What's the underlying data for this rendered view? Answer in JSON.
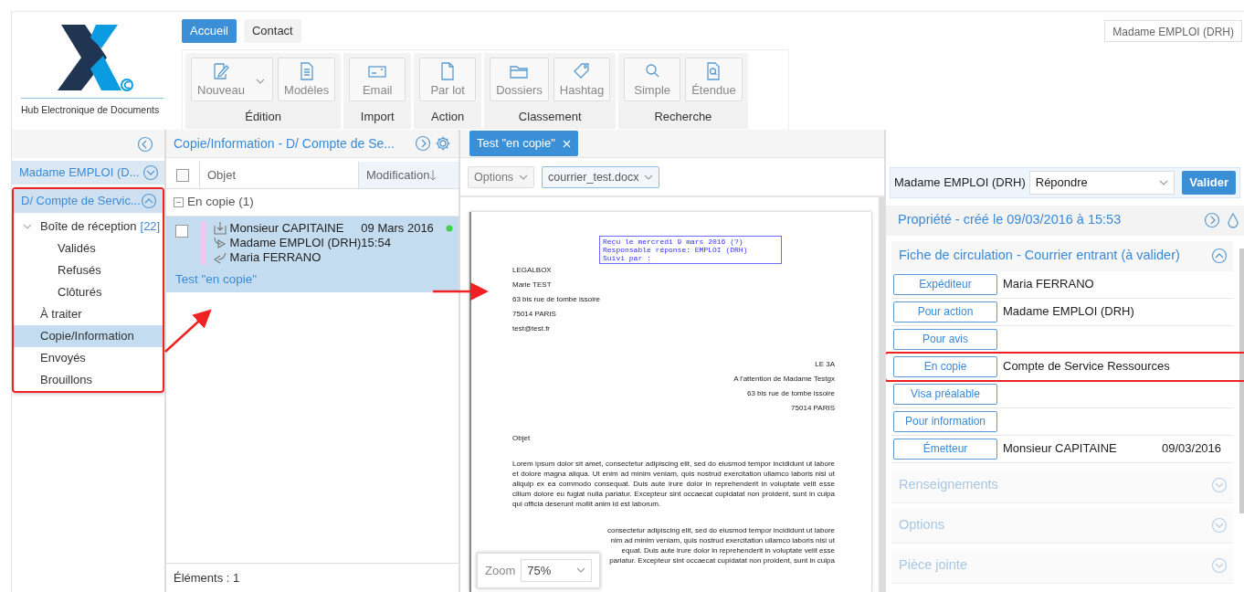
{
  "header": {
    "logo_caption": "Hub Electronique de Documents",
    "user_menu": "Madame EMPLOI (DRH)"
  },
  "nav_tabs": [
    {
      "label": "Accueil",
      "selected": true
    },
    {
      "label": "Contact",
      "selected": false
    }
  ],
  "ribbon_groups": [
    {
      "label": "Édition",
      "buttons": [
        {
          "label": "Nouveau",
          "dropdown": true
        },
        {
          "label": "Modèles",
          "dropdown": false
        }
      ]
    },
    {
      "label": "Import",
      "buttons": [
        {
          "label": "Email",
          "dropdown": false
        }
      ]
    },
    {
      "label": "Action",
      "buttons": [
        {
          "label": "Par lot",
          "dropdown": false
        }
      ]
    },
    {
      "label": "Classement",
      "buttons": [
        {
          "label": "Dossiers",
          "dropdown": false
        },
        {
          "label": "Hashtag",
          "dropdown": false
        }
      ]
    },
    {
      "label": "Recherche",
      "buttons": [
        {
          "label": "Simple",
          "dropdown": false
        },
        {
          "label": "Étendue",
          "dropdown": false
        }
      ]
    }
  ],
  "sidebar": {
    "accounts": [
      {
        "label": "Madame EMPLOI (D...",
        "expanded": false,
        "selected": false
      },
      {
        "label": "D/ Compte de Servic...",
        "expanded": true,
        "selected": true,
        "folders": [
          {
            "label": "Boîte de réception",
            "count": "[22]",
            "expanded": true,
            "selected": false,
            "children": [
              {
                "label": "Validés",
                "selected": false
              },
              {
                "label": "Refusés",
                "selected": false
              },
              {
                "label": "Clôturés",
                "selected": false
              }
            ]
          },
          {
            "label": "À traiter",
            "selected": false
          },
          {
            "label": "Copie/Information",
            "selected": true
          },
          {
            "label": "Envoyés",
            "selected": false
          },
          {
            "label": "Brouillons",
            "selected": false
          }
        ]
      }
    ]
  },
  "message_list": {
    "title": "Copie/Information - D/ Compte de Se...",
    "columns": [
      {
        "label": "Objet",
        "sorted": false
      },
      {
        "label": "Modification",
        "sorted": true
      }
    ],
    "select_all": false,
    "groups": [
      {
        "label": "En copie (1)",
        "expanded": true,
        "rows": [
          {
            "checked": false,
            "selected": true,
            "recipients": [
              {
                "kind": "received",
                "name": "Monsieur CAPITAINE"
              },
              {
                "kind": "forward",
                "name": "Madame EMPLOI (DRH)"
              },
              {
                "kind": "reply",
                "name": "Maria FERRANO"
              }
            ],
            "date": "09 Mars 2016",
            "time": "15:54",
            "subject": "Test \"en copie\""
          }
        ]
      }
    ],
    "footer": "Éléments : 1"
  },
  "viewer": {
    "tabs": [
      {
        "label": "Test \"en copie\"",
        "selected": true
      }
    ],
    "options": "Options",
    "file": "courrier_test.docx",
    "document": {
      "stamp": [
        "Reçu le mercredi 9 mars 2016 (?)",
        "Responsable réponse: EMPLOI (DRH)",
        "Suivi par :"
      ],
      "sender": [
        "LEGALBOX",
        "Marie TEST",
        "63 bis rue de tombe issoire",
        "75014 PARIS",
        "test@test.fr"
      ],
      "recipient": [
        "LE 3A",
        "A l'attention de Madame Testgx",
        "63 bis rue de tombe issoire",
        "75014 PARIS"
      ],
      "subject": "Objet",
      "paragraph": "Lorem ipsum dolor sit amet, consectetur adipiscing elit, sed do eiusmod tempor incididunt ut labore et dolore magna aliqua. Ut enim ad minim veniam, quis nostrud exercitation ullamco laboris nisi ut aliquip ex ea commodo consequat. Duis aute irure dolor in reprehenderit in voluptate velit esse cillum dolore eu fugiat nulla pariatur. Excepteur sint occaecat cupidatat non proident, sunt in culpa qui officia deserunt mollit anim id est laborum.",
      "partial_lines": [
        "consectetur adipiscing elit, sed do eiusmod tempor incididunt ut labore",
        "nim ad minim veniam, quis nostrud exercitation ullamco laboris nisi ut",
        "equat. Duis aute irure dolor in reprehenderit in voluptate velit esse",
        "pariatur. Excepteur sint occaecat cupidatat non proident, sunt in culpa"
      ]
    },
    "zoom": {
      "label": "Zoom",
      "value": "75%"
    }
  },
  "action_bar": {
    "user": "Madame EMPLOI (DRH)",
    "action": "Répondre",
    "submit": "Valider"
  },
  "properties": {
    "title": "Propriété - créé le 09/03/2016 à 15:53",
    "sections": [
      {
        "title": "Fiche de circulation - Courrier entrant (à valider)",
        "expanded": true,
        "rows": [
          {
            "role": "Expéditeur",
            "value": "Maria FERRANO"
          },
          {
            "role": "Pour action",
            "value": "Madame EMPLOI (DRH)"
          },
          {
            "role": "Pour avis"
          },
          {
            "role": "En copie",
            "value": "Compte de Service Ressources"
          },
          {
            "role": "Visa préalable"
          },
          {
            "role": "Pour information"
          },
          {
            "role": "Émetteur",
            "value": "Monsieur CAPITAINE",
            "date": "09/03/2016"
          }
        ]
      },
      {
        "title": "Renseignements",
        "expanded": false
      },
      {
        "title": "Options",
        "expanded": false
      },
      {
        "title": "Pièce jointe",
        "expanded": false
      }
    ]
  }
}
